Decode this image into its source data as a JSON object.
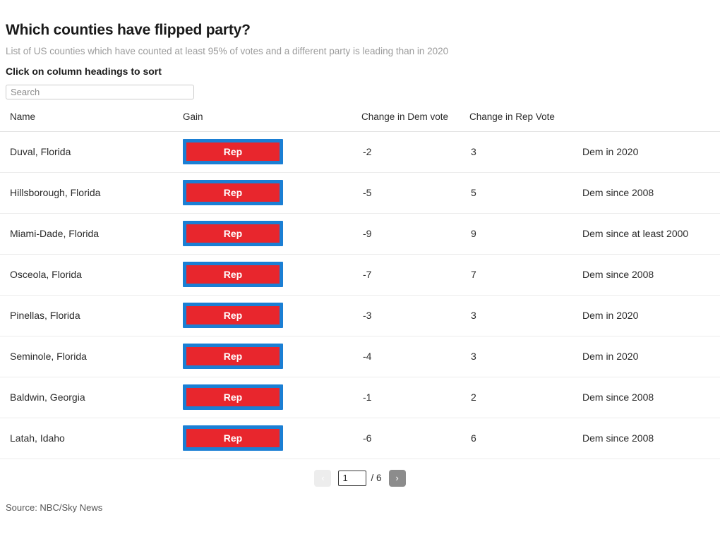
{
  "header": {
    "title": "Which counties have flipped party?",
    "subtitle": "List of US counties which have counted at least 95% of votes and a different party is leading than in 2020",
    "sort_hint": "Click on column headings to sort"
  },
  "search": {
    "placeholder": "Search",
    "value": ""
  },
  "table": {
    "columns": [
      {
        "key": "name",
        "label": "Name"
      },
      {
        "key": "gain",
        "label": "Gain"
      },
      {
        "key": "dem",
        "label": "Change in Dem vote"
      },
      {
        "key": "rep",
        "label": "Change in Rep Vote"
      },
      {
        "key": "note",
        "label": ""
      }
    ],
    "rows": [
      {
        "name": "Duval, Florida",
        "gain": "Rep",
        "dem": "-2",
        "rep": "3",
        "note": "Dem in 2020"
      },
      {
        "name": "Hillsborough, Florida",
        "gain": "Rep",
        "dem": "-5",
        "rep": "5",
        "note": "Dem since 2008"
      },
      {
        "name": "Miami-Dade, Florida",
        "gain": "Rep",
        "dem": "-9",
        "rep": "9",
        "note": "Dem since at least 2000"
      },
      {
        "name": "Osceola, Florida",
        "gain": "Rep",
        "dem": "-7",
        "rep": "7",
        "note": "Dem since 2008"
      },
      {
        "name": "Pinellas, Florida",
        "gain": "Rep",
        "dem": "-3",
        "rep": "3",
        "note": "Dem in 2020"
      },
      {
        "name": "Seminole, Florida",
        "gain": "Rep",
        "dem": "-4",
        "rep": "3",
        "note": "Dem in 2020"
      },
      {
        "name": "Baldwin, Georgia",
        "gain": "Rep",
        "dem": "-1",
        "rep": "2",
        "note": "Dem since 2008"
      },
      {
        "name": "Latah, Idaho",
        "gain": "Rep",
        "dem": "-6",
        "rep": "6",
        "note": "Dem since 2008"
      }
    ]
  },
  "pagination": {
    "prev_label": "‹",
    "next_label": "›",
    "current_page": "1",
    "total_label": "/ 6"
  },
  "footer": {
    "source": "Source: NBC/Sky News"
  },
  "colors": {
    "badge_fill_rep": "#e8262d",
    "badge_border_rep": "#1b7fd4",
    "next_button": "#8c8c8c",
    "prev_button": "#ededed"
  }
}
